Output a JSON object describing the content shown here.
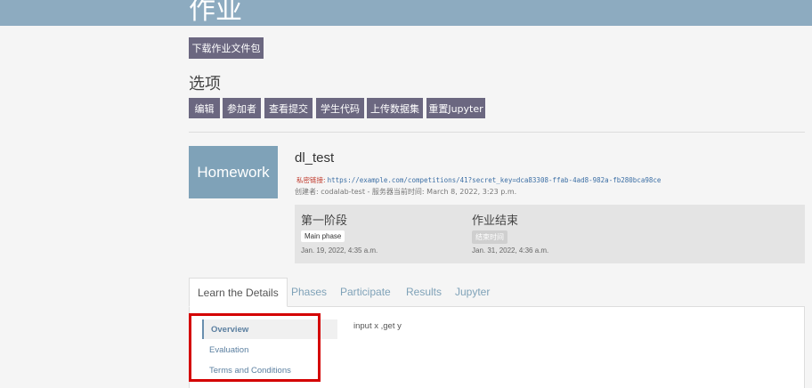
{
  "header": {
    "title": "作业"
  },
  "download_button": "下载作业文件包",
  "options": {
    "title": "选项",
    "buttons": [
      "编辑",
      "参加者",
      "查看提交",
      "学生代码",
      "上传数据集",
      "重置Jupyter"
    ]
  },
  "competition": {
    "logo_text": "Homework",
    "title": "dl_test",
    "secret_label": "私密链接:",
    "secret_url": "https://example.com/competitions/41?secret_key=dca83308-ffab-4ad8-982a-fb280bca98ce",
    "creator_line": "创建者:  codalab-test - 服务器当前时间: March 8, 2022, 3:23 p.m."
  },
  "phases": [
    {
      "title": "第一阶段",
      "badge": "Main phase",
      "date": "Jan. 19, 2022, 4:35 a.m."
    },
    {
      "title": "作业结束",
      "badge": "结束时间",
      "date": "Jan. 31, 2022, 4:36 a.m."
    }
  ],
  "tabs": [
    "Learn the Details",
    "Phases",
    "Participate",
    "Results",
    "Jupyter"
  ],
  "sidebar": [
    "Overview",
    "Evaluation",
    "Terms and Conditions"
  ],
  "overview_text": "input x ,get y"
}
